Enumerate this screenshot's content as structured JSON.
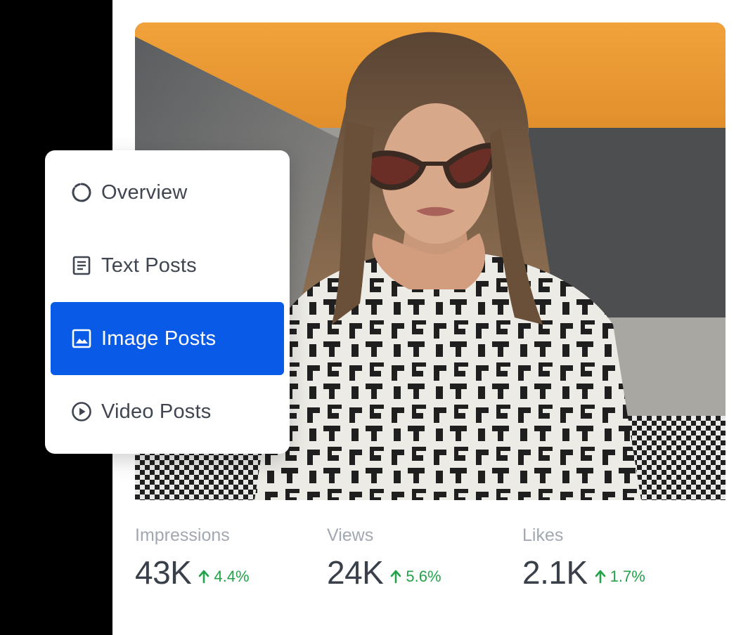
{
  "menu": {
    "items": [
      {
        "label": "Overview",
        "icon": "overview-ring-icon",
        "active": false
      },
      {
        "label": "Text Posts",
        "icon": "document-icon",
        "active": false
      },
      {
        "label": "Image Posts",
        "icon": "image-icon",
        "active": true
      },
      {
        "label": "Video Posts",
        "icon": "play-circle-icon",
        "active": false
      }
    ]
  },
  "stats": [
    {
      "label": "Impressions",
      "value": "43K",
      "delta": "4.4%"
    },
    {
      "label": "Views",
      "value": "24K",
      "delta": "5.6%"
    },
    {
      "label": "Likes",
      "value": "2.1K",
      "delta": "1.7%"
    }
  ],
  "colors": {
    "accent": "#0a5ae8",
    "positive": "#22a34a",
    "text_primary": "#3a404a",
    "text_muted": "#a2a8b2"
  }
}
